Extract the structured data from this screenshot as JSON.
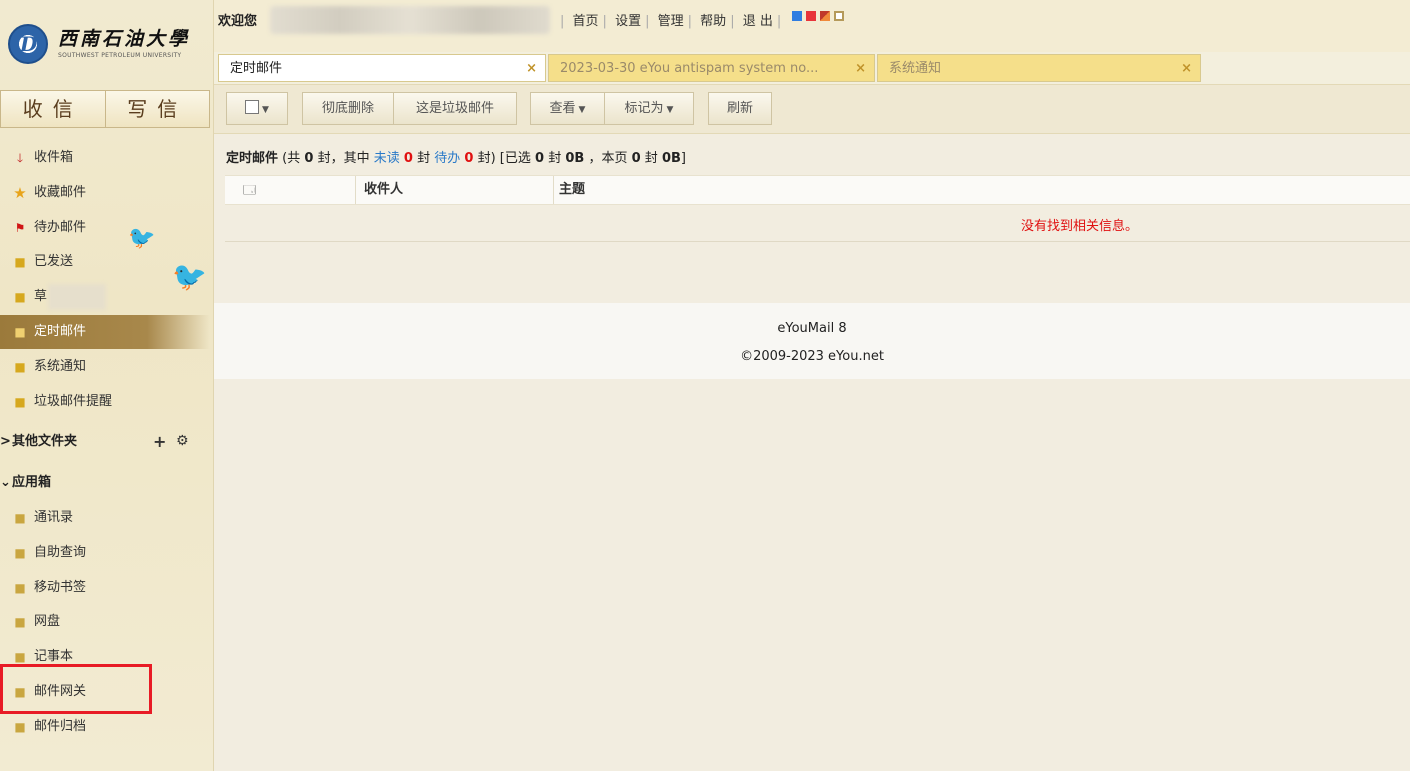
{
  "header": {
    "welcome": "欢迎您",
    "links": [
      "首页",
      "设置",
      "管理",
      "帮助",
      "退 出"
    ],
    "theme_colors": [
      "#2f7de1",
      "#e8353a",
      "#c0392b",
      "#b59a5a"
    ]
  },
  "logo": {
    "name_cn": "西南石油大學",
    "name_en": "SOUTHWEST PETROLEUM UNIVERSITY"
  },
  "main_buttons": {
    "inbox": "收信",
    "compose": "写信"
  },
  "sidebar": {
    "folders": [
      {
        "label": "收件箱",
        "icon": "arrow-down-icon"
      },
      {
        "label": "收藏邮件",
        "icon": "star-icon"
      },
      {
        "label": "待办邮件",
        "icon": "flag-icon"
      },
      {
        "label": "已发送",
        "icon": "folder-icon"
      },
      {
        "label": "草",
        "icon": "folder-icon"
      },
      {
        "label": "定时邮件",
        "icon": "folder-icon",
        "active": true
      },
      {
        "label": "系统通知",
        "icon": "folder-icon"
      },
      {
        "label": "垃圾邮件提醒",
        "icon": "folder-icon"
      }
    ],
    "other_folders": {
      "arrow": ">",
      "label": "其他文件夹",
      "add": "+",
      "settings": "⚙"
    },
    "apps_section": {
      "arrow": "⌄",
      "label": "应用箱"
    },
    "apps": [
      {
        "label": "通讯录"
      },
      {
        "label": "自助查询"
      },
      {
        "label": "移动书签"
      },
      {
        "label": "网盘"
      },
      {
        "label": "记事本"
      },
      {
        "label": "邮件网关",
        "highlighted": true
      },
      {
        "label": "邮件归档"
      }
    ]
  },
  "tabs": [
    {
      "label": "定时邮件",
      "active": true
    },
    {
      "label": "2023-03-30 eYou antispam system no...",
      "active": false
    },
    {
      "label": "系统通知",
      "active": false
    }
  ],
  "toolbar": {
    "delete_permanently": "彻底删除",
    "mark_spam": "这是垃圾邮件",
    "view": "查看",
    "mark_as": "标记为",
    "refresh": "刷新"
  },
  "summary": {
    "folder": "定时邮件",
    "p1": "(共",
    "total": "0",
    "p2": "封，其中",
    "unread_label": "未读",
    "unread": "0",
    "p3": "封",
    "todo_label": "待办",
    "todo": "0",
    "p4": "封)",
    "p5": "[已选",
    "selected": "0",
    "p6": "封",
    "selected_size": "0B",
    "p7": "，本页",
    "page_count": "0",
    "p8": "封",
    "page_size": "0B",
    "p9": "]"
  },
  "table": {
    "columns": [
      "收件人",
      "主题"
    ],
    "empty_message": "没有找到相关信息。"
  },
  "footer": {
    "product": "eYouMail 8",
    "copyright": "©2009-2023 eYou.net"
  }
}
